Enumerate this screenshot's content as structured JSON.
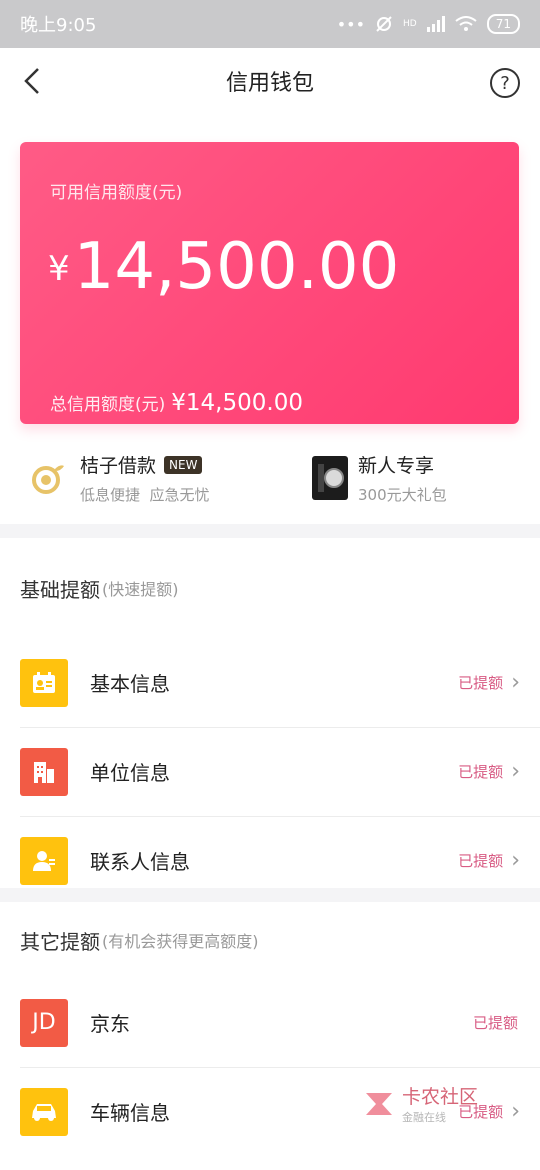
{
  "status_bar": {
    "time": "晚上9:05",
    "signal_label": "HD",
    "battery": "71"
  },
  "nav": {
    "title": "信用钱包",
    "help_symbol": "?"
  },
  "card": {
    "label": "可用信用额度(元)",
    "currency": "¥",
    "available_amount": "14,500.00",
    "total_label": "总信用额度(元)",
    "total_amount": "¥14,500.00"
  },
  "promos": [
    {
      "title": "桔子借款",
      "badge": "NEW",
      "subtitle": "低息便捷  应急无忧"
    },
    {
      "title": "新人专享",
      "subtitle": "300元大礼包"
    }
  ],
  "basic_section": {
    "title": "基础提额",
    "subtitle": "(快速提额)",
    "items": [
      {
        "label": "基本信息",
        "status": "已提额",
        "icon": "id-card-icon",
        "color": "#ffc20e"
      },
      {
        "label": "单位信息",
        "status": "已提额",
        "icon": "building-icon",
        "color": "#f25b45"
      },
      {
        "label": "联系人信息",
        "status": "已提额",
        "icon": "contact-icon",
        "color": "#ffc20e"
      }
    ]
  },
  "other_section": {
    "title": "其它提额",
    "subtitle": "(有机会获得更高额度)",
    "items": [
      {
        "label": "京东",
        "status": "已提额",
        "icon": "jd-icon",
        "icon_text": "JD",
        "color": "#f25b45"
      },
      {
        "label": "车辆信息",
        "status": "已提额",
        "icon": "car-icon",
        "color": "#ffc20e"
      }
    ]
  },
  "watermark": {
    "text": "卡农社区",
    "subtext": "金融在线"
  }
}
